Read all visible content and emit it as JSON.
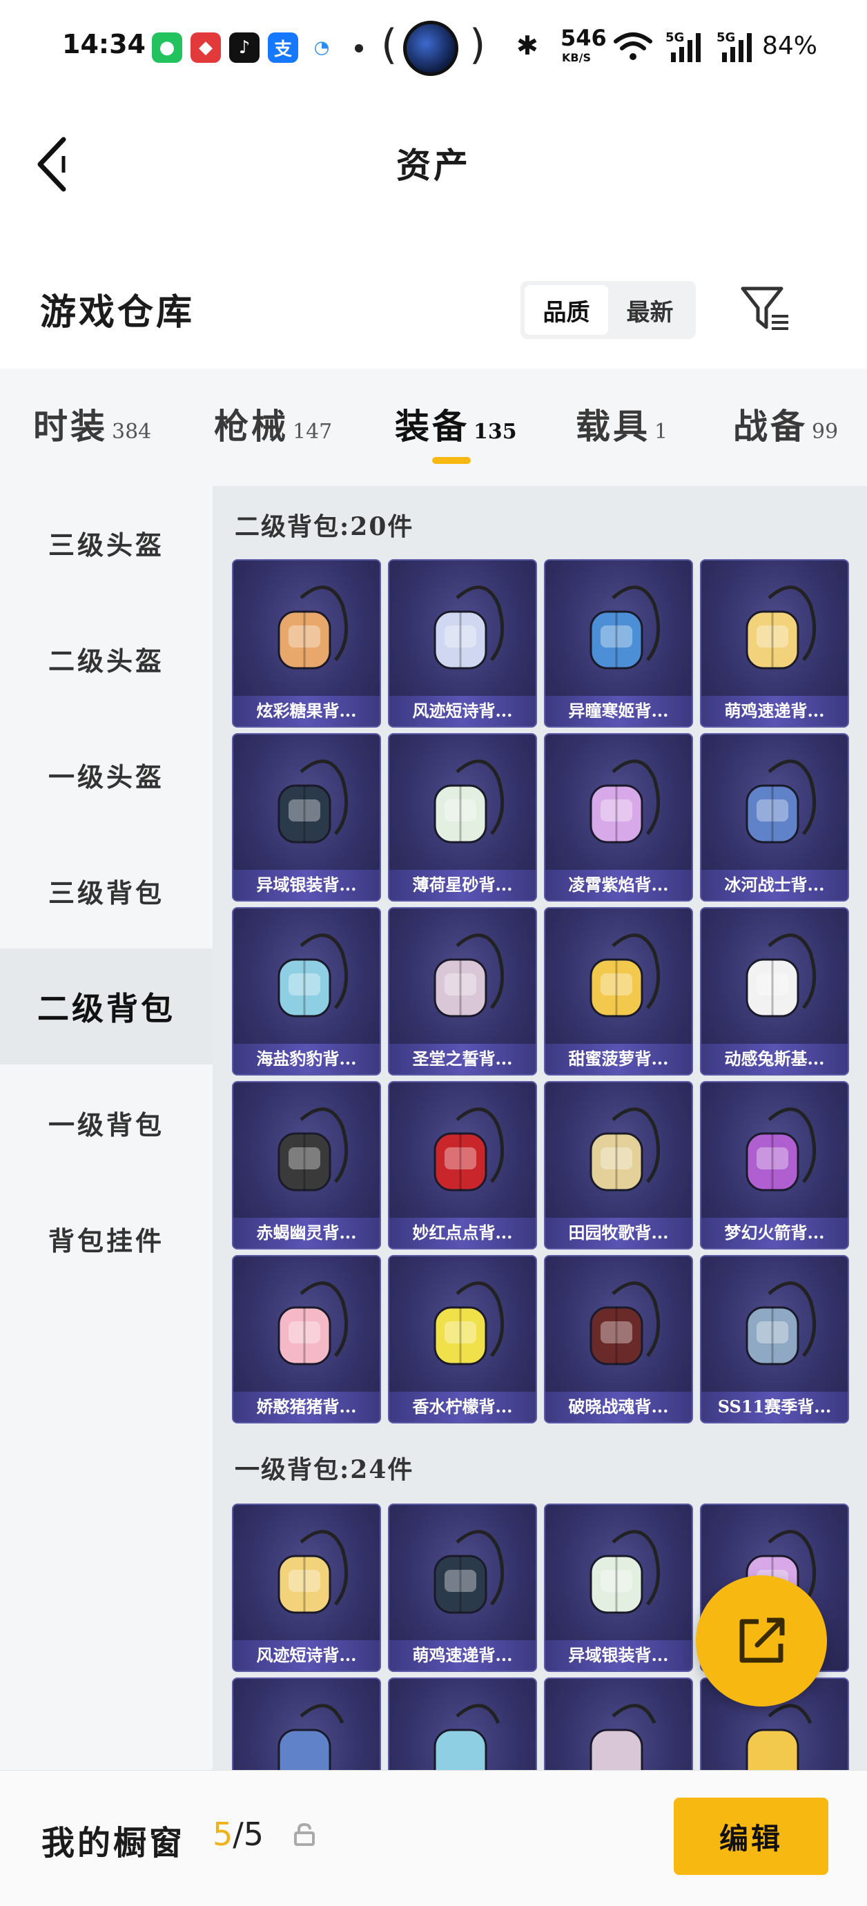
{
  "status_bar": {
    "time": "14:34",
    "net_speed": "546",
    "net_unit": "KB/S",
    "signal1": "5G",
    "signal2": "5G",
    "battery": "84%"
  },
  "header": {
    "title": "资产"
  },
  "warehouse": {
    "title": "游戏仓库",
    "sort_options": [
      "品质",
      "最新"
    ],
    "sort_selected": "品质"
  },
  "tabs": [
    {
      "label": "时装",
      "count": "384"
    },
    {
      "label": "枪械",
      "count": "147"
    },
    {
      "label": "装备",
      "count": "135"
    },
    {
      "label": "载具",
      "count": "1"
    },
    {
      "label": "战备",
      "count": "99"
    }
  ],
  "active_tab": "装备",
  "sidebar": {
    "items": [
      "三级头盔",
      "二级头盔",
      "一级头盔",
      "三级背包",
      "二级背包",
      "一级背包",
      "背包挂件"
    ],
    "active": "二级背包"
  },
  "groups": [
    {
      "title": "二级背包:20件",
      "items": [
        "炫彩糖果背...",
        "风迹短诗背...",
        "异瞳寒姬背...",
        "萌鸡速递背...",
        "异域银装背...",
        "薄荷星砂背...",
        "凌霄紫焰背...",
        "冰河战士背...",
        "海盐豹豹背...",
        "圣堂之誓背...",
        "甜蜜菠萝背...",
        "动感兔斯基...",
        "赤蝎幽灵背...",
        "妙红点点背...",
        "田园牧歌背...",
        "梦幻火箭背...",
        "娇憨猪猪背...",
        "香水柠檬背...",
        "破晓战魂背...",
        "SS11赛季背..."
      ]
    },
    {
      "title": "一级背包:24件",
      "items": [
        "风迹短诗背...",
        "萌鸡速递背...",
        "异域银装背...",
        ""
      ]
    }
  ],
  "bottom_bar": {
    "label": "我的橱窗",
    "current": "5",
    "total": "/5",
    "edit_label": "编辑"
  },
  "colors": {
    "accent": "#f7b812",
    "card_bg": "#333168",
    "card_label_bg": "#5a54b4"
  }
}
